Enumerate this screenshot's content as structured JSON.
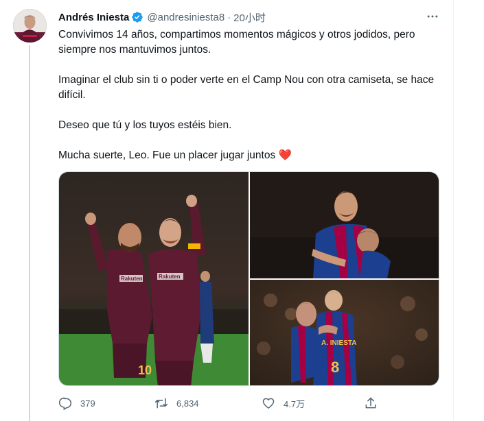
{
  "tweet": {
    "author_name": "Andrés Iniesta",
    "handle": "@andresiniesta8",
    "separator": "·",
    "time": "20小时",
    "paragraphs": [
      "Convivimos 14 años, compartimos momentos mágicos y otros jodidos, pero siempre nos mantuvimos juntos.",
      "Imaginar el club sin ti o poder verte en el Camp Nou con otra camiseta, se hace difícil.",
      "Deseo que tú y los tuyos estéis bien.",
      "Mucha suerte, Leo. Fue un placer jugar juntos"
    ],
    "heart_emoji": "❤️",
    "media": [
      {
        "icon": "photo-celebration"
      },
      {
        "icon": "photo-hug-night"
      },
      {
        "icon": "photo-hug-crowd"
      }
    ],
    "jersey_texts": {
      "photo1_sponsor_left": "Rakuten",
      "photo1_sponsor_right": "Rakuten",
      "photo1_number": "10",
      "photo3_back_name": "A. INIESTA",
      "photo3_number": "8"
    }
  },
  "actions": {
    "reply_count": "379",
    "retweet_count": "6,834",
    "like_count": "4.7万"
  },
  "colors": {
    "verified_blue": "#1d9bf0",
    "secondary_text": "#536471",
    "heart": "#e0245e"
  }
}
